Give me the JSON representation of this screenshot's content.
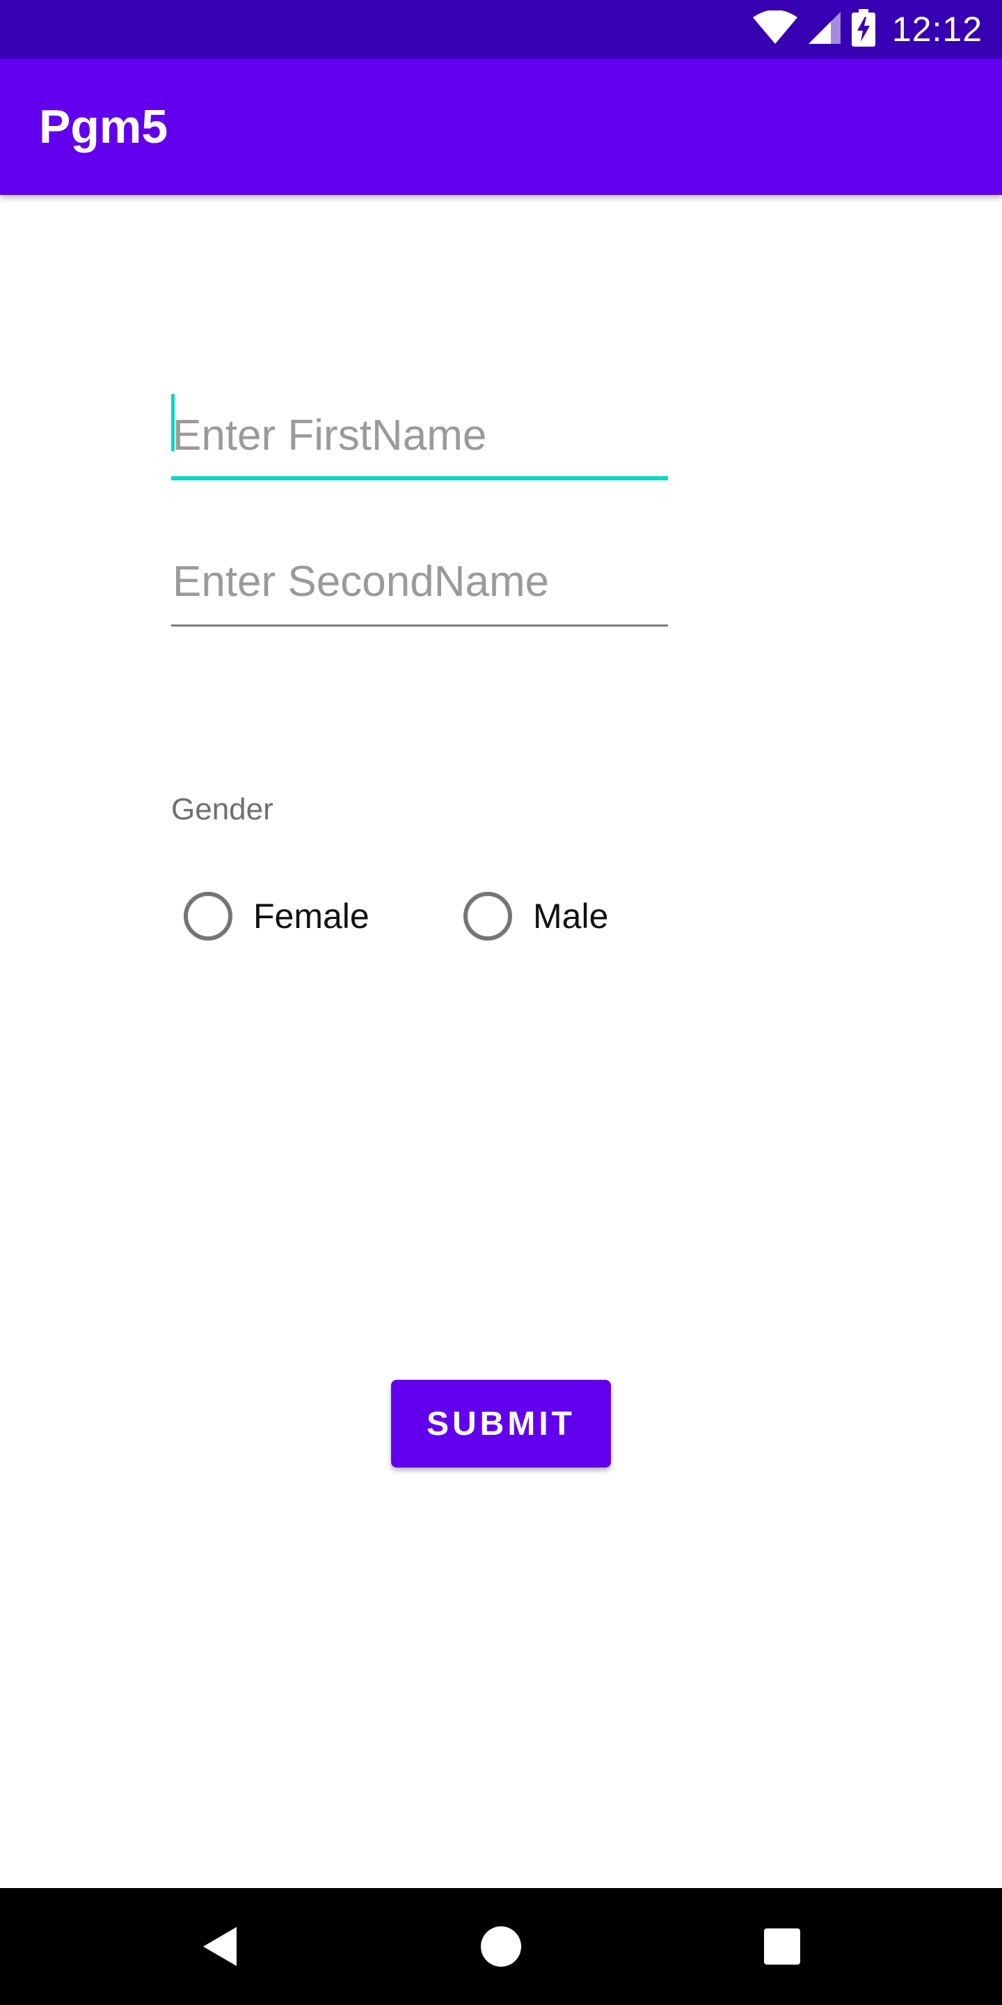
{
  "status_bar": {
    "time": "12:12",
    "icons": [
      "wifi-icon",
      "cellular-signal-icon",
      "battery-charging-icon"
    ]
  },
  "app_bar": {
    "title": "Pgm5"
  },
  "form": {
    "first_name": {
      "value": "",
      "placeholder": "Enter FirstName"
    },
    "second_name": {
      "value": "",
      "placeholder": "Enter SecondName"
    },
    "gender_label": "Gender",
    "gender_options": [
      {
        "label": "Female",
        "selected": false
      },
      {
        "label": "Male",
        "selected": false
      }
    ],
    "submit_label": "SUBMIT"
  },
  "nav_bar": {
    "buttons": [
      "back-icon",
      "home-icon",
      "recents-icon"
    ]
  },
  "colors": {
    "status_bar": "#3700b3",
    "primary": "#6200ee",
    "accent": "#03dac5"
  }
}
